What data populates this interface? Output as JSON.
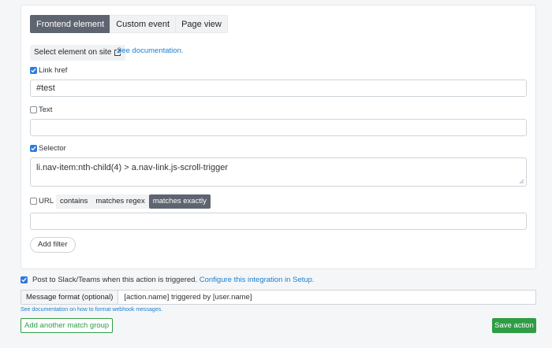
{
  "tabs": [
    {
      "label": "Frontend element",
      "active": true
    },
    {
      "label": "Custom event",
      "active": false
    },
    {
      "label": "Page view",
      "active": false
    }
  ],
  "select_element": {
    "label": "Select element on site",
    "icon": "external-link-icon"
  },
  "see_documentation": "See documentation.",
  "link_href": {
    "label": "Link href",
    "checked": true,
    "value": "#test"
  },
  "text": {
    "label": "Text",
    "checked": false,
    "value": ""
  },
  "selector": {
    "label": "Selector",
    "checked": true,
    "value": "li.nav-item:nth-child(4) > a.nav-link.js-scroll-trigger"
  },
  "url": {
    "label": "URL",
    "checked": false,
    "value": "",
    "options": [
      "contains",
      "matches regex",
      "matches exactly"
    ],
    "selected": "matches exactly"
  },
  "add_filter": "Add filter",
  "slack": {
    "checked": true,
    "text": "Post to Slack/Teams when this action is triggered.",
    "link": "Configure this integration in Setup."
  },
  "message_format": {
    "label": "Message format (optional)",
    "value": "[action.name] triggered by [user.name]"
  },
  "webhook_doc": "See documentation on how to format webhook messages.",
  "add_group": "Add another match group",
  "save": "Save action",
  "colors": {
    "primary": "#2f7be0",
    "success": "#2e9d45",
    "active_segment": "#5e6470",
    "link": "#1a7fd1"
  }
}
